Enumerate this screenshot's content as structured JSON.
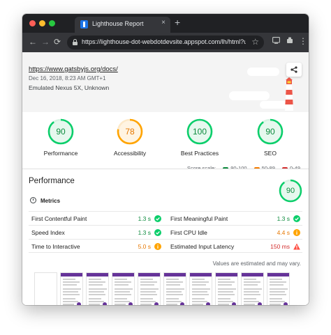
{
  "browser": {
    "tab_title": "Lighthouse Report",
    "tab_close": "×",
    "new_tab": "+",
    "back": "←",
    "forward": "→",
    "reload": "⟳",
    "url": "https://lighthouse-dot-webdotdevsite.appspot.com/lh/html?url=https://...",
    "star": "☆",
    "menu": "⋮"
  },
  "report": {
    "site_url": "https://www.gatsbyjs.org/docs/",
    "run_date": "Dec 16, 2018, 8:23 AM GMT+1",
    "device": "Emulated Nexus 5X, Unknown",
    "share_icon": "share-icon"
  },
  "scores": [
    {
      "label": "Performance",
      "value": "90",
      "score": 90,
      "color": "#0cce6b",
      "text_color": "#0d8a3d"
    },
    {
      "label": "Accessibility",
      "value": "78",
      "score": 78,
      "color": "#ffa400",
      "text_color": "#e67700"
    },
    {
      "label": "Best Practices",
      "value": "100",
      "score": 100,
      "color": "#0cce6b",
      "text_color": "#0d8a3d"
    },
    {
      "label": "SEO",
      "value": "90",
      "score": 90,
      "color": "#0cce6b",
      "text_color": "#0d8a3d"
    }
  ],
  "scale": {
    "label": "Score scale:",
    "ranges": [
      {
        "label": "90-100",
        "color": "#0d8a3d"
      },
      {
        "label": "50-89",
        "color": "#f57c00"
      },
      {
        "label": "0-49",
        "color": "#d32f2f"
      }
    ]
  },
  "performance": {
    "title": "Performance",
    "score": "90",
    "metrics_heading": "Metrics",
    "metrics": [
      {
        "label": "First Contentful Paint",
        "value": "1.3 s",
        "status": "pass"
      },
      {
        "label": "First Meaningful Paint",
        "value": "1.3 s",
        "status": "pass"
      },
      {
        "label": "Speed Index",
        "value": "1.3 s",
        "status": "pass"
      },
      {
        "label": "First CPU Idle",
        "value": "4.4 s",
        "status": "average"
      },
      {
        "label": "Time to Interactive",
        "value": "5.0 s",
        "status": "average"
      },
      {
        "label": "Estimated Input Latency",
        "value": "150 ms",
        "status": "fail"
      }
    ],
    "note": "Values are estimated and may vary."
  },
  "status_colors": {
    "pass": "#0d8a3d",
    "average": "#e67700",
    "fail": "#d32f2f"
  }
}
